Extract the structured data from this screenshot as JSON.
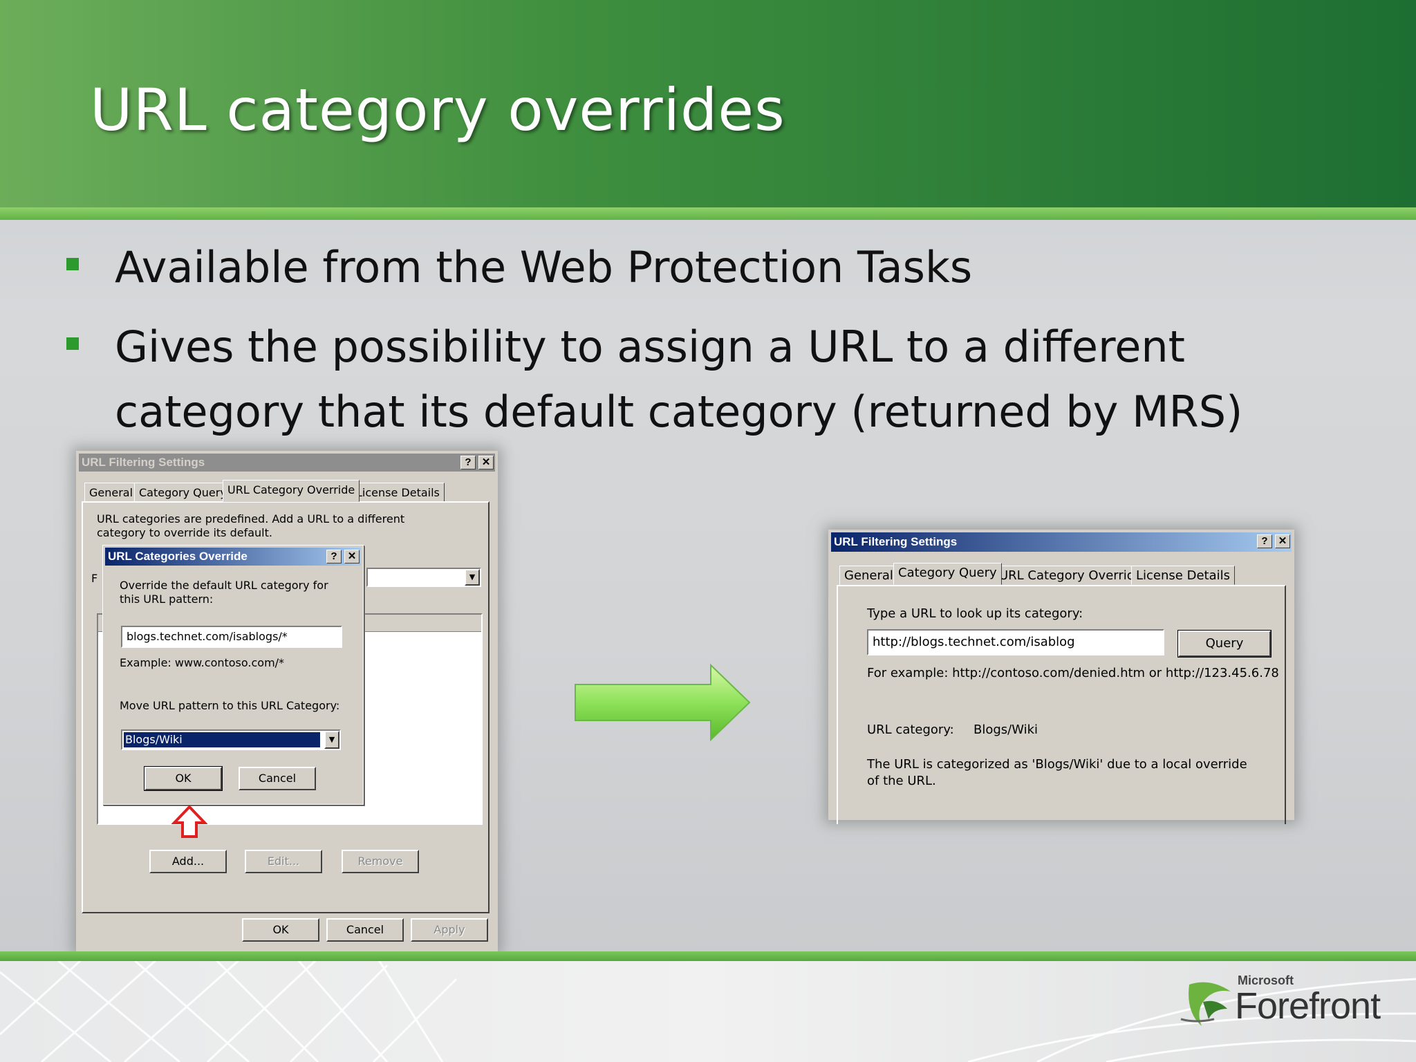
{
  "slide": {
    "title": "URL category overrides",
    "bullets": [
      "Available from the Web Protection Tasks",
      "Gives the possibility to assign a URL to a different category that its default category (returned by MRS)"
    ]
  },
  "left_dialog": {
    "title": "URL Filtering Settings",
    "help_btn": "?",
    "close_btn": "✕",
    "tabs": [
      "General",
      "Category Query",
      "URL Category Override",
      "License Details"
    ],
    "selected_tab": "URL Category Override",
    "description": "URL categories are predefined. Add a URL to a different category to override its default.",
    "hidden_label": "F",
    "add_btn": "Add...",
    "edit_btn": "Edit...",
    "remove_btn": "Remove",
    "ok_btn": "OK",
    "cancel_btn": "Cancel",
    "apply_btn": "Apply"
  },
  "override_dialog": {
    "title": "URL Categories Override",
    "help_btn": "?",
    "close_btn": "✕",
    "instruction": "Override the default URL category for this URL pattern:",
    "pattern_value": "blogs.technet.com/isablogs/*",
    "example": "Example: www.contoso.com/*",
    "move_label": "Move URL pattern to this URL Category:",
    "category_value": "Blogs/Wiki",
    "ok_btn": "OK",
    "cancel_btn": "Cancel"
  },
  "right_dialog": {
    "title": "URL Filtering Settings",
    "help_btn": "?",
    "close_btn": "✕",
    "tabs": [
      "General",
      "Category Query",
      "URL Category Override",
      "License Details"
    ],
    "selected_tab": "Category Query",
    "prompt": "Type a URL to look up its category:",
    "url_value": "http://blogs.technet.com/isablog",
    "query_btn": "Query",
    "example": "For example: http://contoso.com/denied.htm or http://123.45.6.78",
    "category_label": "URL category:",
    "category_value": "Blogs/Wiki",
    "result_text": "The URL is categorized as 'Blogs/Wiki' due to a local override of the URL."
  },
  "logo": {
    "company": "Microsoft",
    "product": "Forefront"
  },
  "colors": {
    "header_green": "#3f8f3f",
    "bullet_green": "#2d9a2d",
    "arrow_green": "#8ee25a",
    "callout_red": "#e02020",
    "dialog_gray": "#d4d0c8",
    "titlebar_blue": "#0a246a"
  }
}
